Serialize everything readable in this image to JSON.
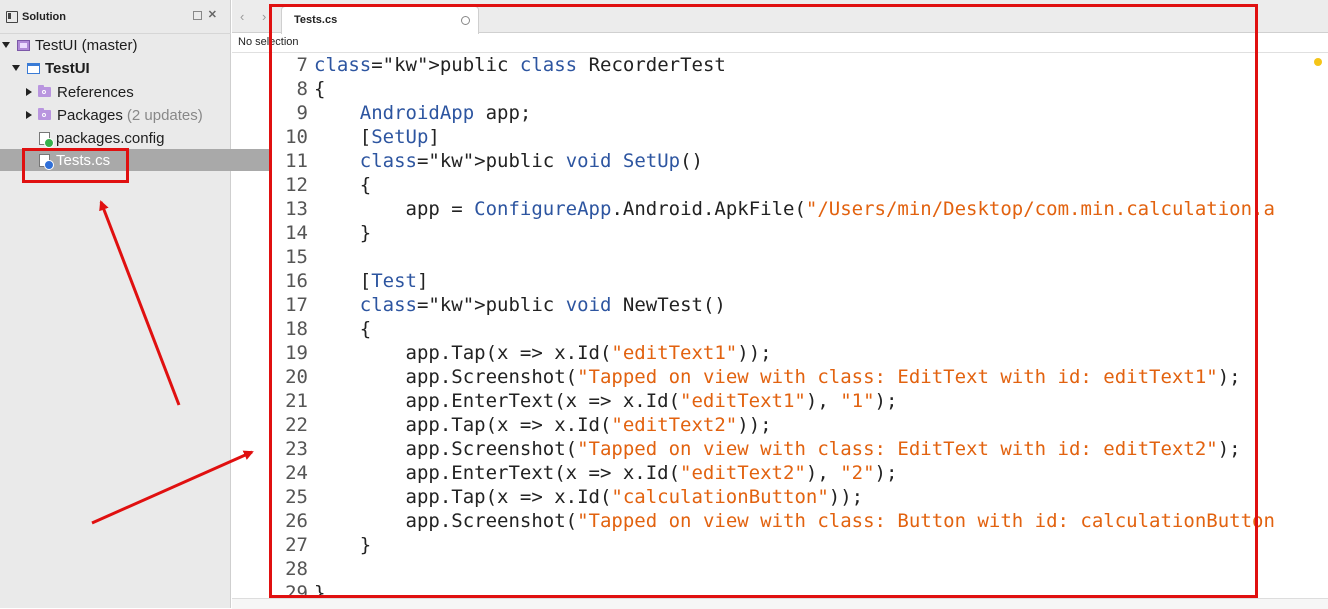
{
  "sidebar": {
    "title": "Solution",
    "tree": [
      {
        "label": "TestUI (master)",
        "suffix": ""
      },
      {
        "label": "TestUI",
        "suffix": ""
      },
      {
        "label": "References",
        "suffix": ""
      },
      {
        "label": "Packages",
        "suffix": "(2 updates)"
      },
      {
        "label": "packages.config",
        "suffix": ""
      },
      {
        "label": "Tests.cs",
        "suffix": ""
      }
    ]
  },
  "editor": {
    "tab_label": "Tests.cs",
    "breadcrumb": "No selection"
  },
  "code_lines": [
    {
      "n": "7",
      "text": "public class RecorderTest"
    },
    {
      "n": "8",
      "text": "{"
    },
    {
      "n": "9",
      "text": "    AndroidApp app;"
    },
    {
      "n": "10",
      "text": "    [SetUp]"
    },
    {
      "n": "11",
      "text": "    public void SetUp()"
    },
    {
      "n": "12",
      "text": "    {"
    },
    {
      "n": "13",
      "text": "        app = ConfigureApp.Android.ApkFile(\"/Users/min/Desktop/com.min.calculation.a"
    },
    {
      "n": "14",
      "text": "    }"
    },
    {
      "n": "15",
      "text": ""
    },
    {
      "n": "16",
      "text": "    [Test]"
    },
    {
      "n": "17",
      "text": "    public void NewTest()"
    },
    {
      "n": "18",
      "text": "    {"
    },
    {
      "n": "19",
      "text": "        app.Tap(x => x.Id(\"editText1\"));"
    },
    {
      "n": "20",
      "text": "        app.Screenshot(\"Tapped on view with class: EditText with id: editText1\");"
    },
    {
      "n": "21",
      "text": "        app.EnterText(x => x.Id(\"editText1\"), \"1\");"
    },
    {
      "n": "22",
      "text": "        app.Tap(x => x.Id(\"editText2\"));"
    },
    {
      "n": "23",
      "text": "        app.Screenshot(\"Tapped on view with class: EditText with id: editText2\");"
    },
    {
      "n": "24",
      "text": "        app.EnterText(x => x.Id(\"editText2\"), \"2\");"
    },
    {
      "n": "25",
      "text": "        app.Tap(x => x.Id(\"calculationButton\"));"
    },
    {
      "n": "26",
      "text": "        app.Screenshot(\"Tapped on view with class: Button with id: calculationButton"
    },
    {
      "n": "27",
      "text": "    }"
    },
    {
      "n": "28",
      "text": ""
    },
    {
      "n": "29",
      "text": "}"
    }
  ],
  "colors": {
    "keyword": "#2d55a0",
    "string": "#e2620f",
    "annotation": "#e01010",
    "selection": "#a9a9a9"
  }
}
